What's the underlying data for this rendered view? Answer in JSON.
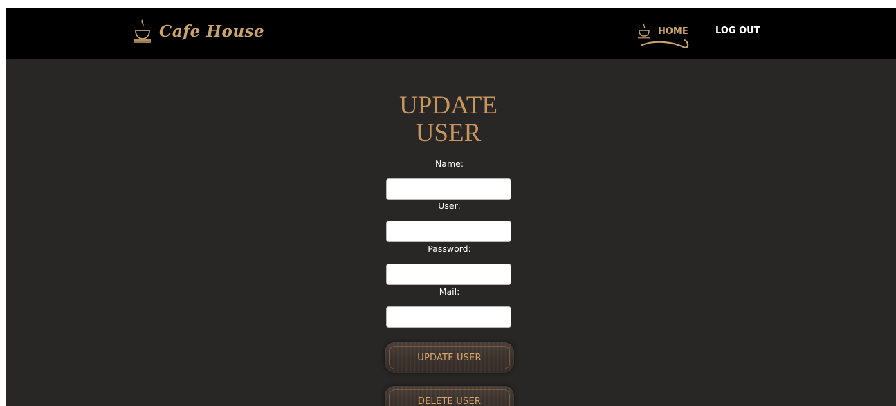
{
  "brand": {
    "name": "Cafe House",
    "icon": "coffee-cup-icon"
  },
  "nav": {
    "home_label": "HOME",
    "home_icon": "coffee-cup-icon",
    "logout_label": "LOG OUT"
  },
  "form": {
    "title_line1": "UPDATE",
    "title_line2": "USER",
    "fields": [
      {
        "label": "Name:",
        "value": "",
        "placeholder": ""
      },
      {
        "label": "User:",
        "value": "",
        "placeholder": ""
      },
      {
        "label": "Password:",
        "value": "",
        "placeholder": ""
      },
      {
        "label": "Mail:",
        "value": "",
        "placeholder": ""
      }
    ],
    "update_button": "UPDATE USER",
    "delete_button": "DELETE USER"
  },
  "colors": {
    "page_bg": "#282725",
    "navbar_bg": "#000000",
    "accent_gold": "#c9a46e",
    "title_color": "#c9955f",
    "button_text": "#d8a56e"
  }
}
